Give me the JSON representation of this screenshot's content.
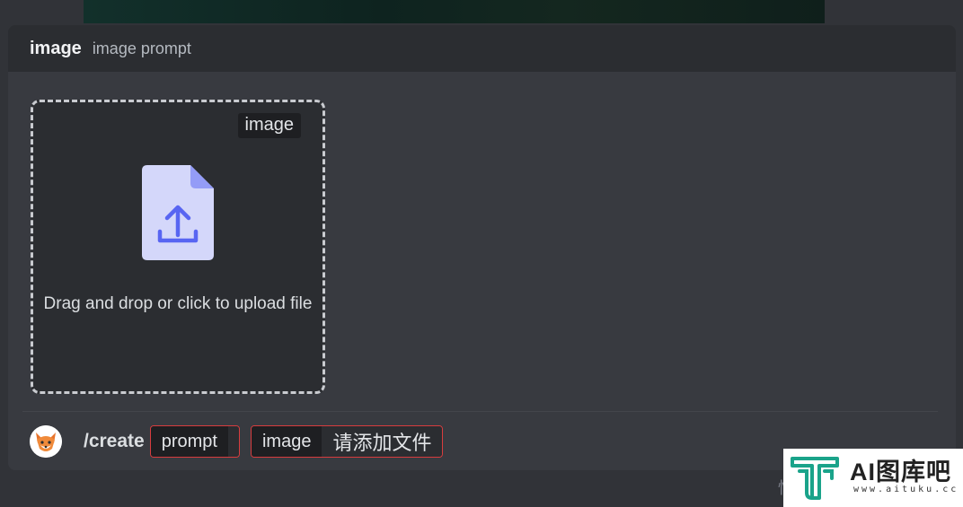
{
  "panel": {
    "title": "image",
    "subtitle": "image prompt"
  },
  "dropzone": {
    "tag": "image",
    "text": "Drag and drop or click to upload file",
    "icon": "file-upload-icon"
  },
  "command": {
    "name": "/create",
    "options": [
      {
        "name": "prompt",
        "value": ""
      },
      {
        "name": "image",
        "value": "请添加文件"
      }
    ]
  },
  "bottom_glyph": "忙",
  "watermark": {
    "name": "AI图库吧",
    "url": "www.aituku.cc",
    "icon": "aituku-logo-icon"
  },
  "colors": {
    "background": "#313338",
    "panel": "#383a40",
    "header": "#2b2d31",
    "error_border": "#d83c3e",
    "file_icon_body": "#d4d7fa",
    "file_icon_accent": "#5865f2",
    "watermark_teal": "#1aa38a"
  }
}
